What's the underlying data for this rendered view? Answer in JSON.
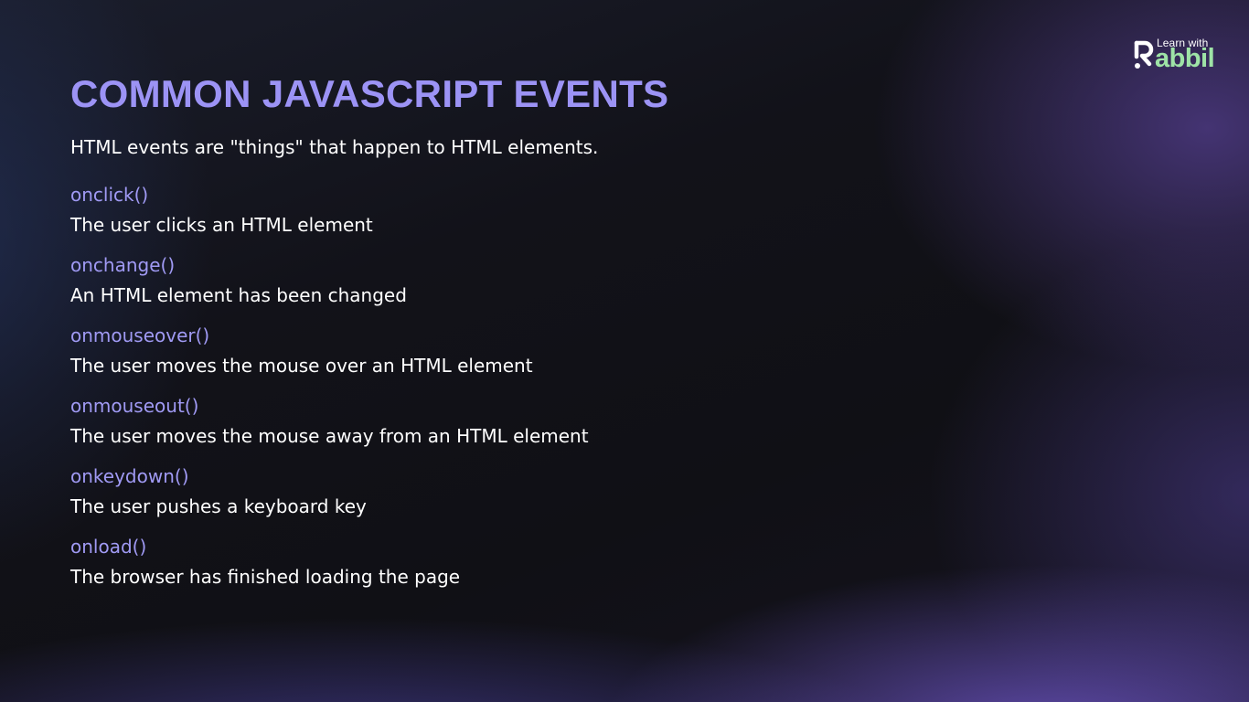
{
  "brand": {
    "small_text": "Learn with",
    "name_text": "abbil",
    "accent_color": "#9ee3a6"
  },
  "slide": {
    "title": "COMMON JAVASCRIPT EVENTS",
    "intro": "HTML events are \"things\" that happen to HTML elements.",
    "title_color": "#9c93f5",
    "event_name_color": "#a09af4"
  },
  "events": [
    {
      "name": "onclick()",
      "description": "The user clicks an HTML element"
    },
    {
      "name": "onchange()",
      "description": "An HTML element has been changed"
    },
    {
      "name": "onmouseover()",
      "description": "The user moves the mouse over an HTML element"
    },
    {
      "name": "onmouseout()",
      "description": "The user moves the mouse away from an HTML element"
    },
    {
      "name": "onkeydown()",
      "description": "The user pushes a keyboard key"
    },
    {
      "name": "onload()",
      "description": "The browser has finished loading the page"
    }
  ]
}
